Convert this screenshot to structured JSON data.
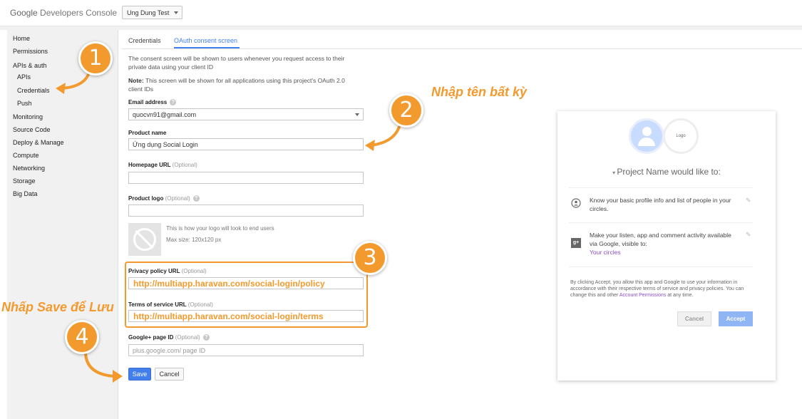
{
  "header": {
    "logo_google": "Google",
    "logo_product": "Developers Console",
    "project": "Ung Dung Test"
  },
  "sidebar": {
    "items": [
      {
        "label": "Home"
      },
      {
        "label": "Permissions"
      },
      {
        "label": "APIs & auth"
      },
      {
        "label": "APIs"
      },
      {
        "label": "Credentials"
      },
      {
        "label": "Push"
      },
      {
        "label": "Monitoring"
      },
      {
        "label": "Source Code"
      },
      {
        "label": "Deploy & Manage"
      },
      {
        "label": "Compute"
      },
      {
        "label": "Networking"
      },
      {
        "label": "Storage"
      },
      {
        "label": "Big Data"
      }
    ]
  },
  "tabs": [
    {
      "label": "Credentials"
    },
    {
      "label": "OAuth consent screen"
    }
  ],
  "form": {
    "intro_line1": "The consent screen will be shown to users whenever you request access to their",
    "intro_line2": "private data using your client ID",
    "note_label": "Note:",
    "note_line1": " This screen will be shown for all applications using this project's OAuth 2.0",
    "note_line2": "client IDs",
    "email_label": "Email address",
    "email_value": "quocvn91@gmail.com",
    "product_label": "Product name",
    "product_value": "Ứng dụng Social Login",
    "homepage_label": "Homepage URL",
    "homepage_opt": "(Optional)",
    "logo_label": "Product logo",
    "logo_opt": "(Optional)",
    "logo_hint1": "This is how your logo will look to end users",
    "logo_hint2": "Max size: 120x120 px",
    "privacy_label": "Privacy policy URL",
    "privacy_opt": "(Optional)",
    "privacy_value": "http://multiapp.haravan.com/social-login/policy",
    "terms_label": "Terms of service URL",
    "terms_opt": "(Optional)",
    "terms_value": "http://multiapp.haravan.com/social-login/terms",
    "gplus_label": "Google+ page ID",
    "gplus_opt": "(Optional)",
    "gplus_placeholder": "plus.google.com/ page ID",
    "save": "Save",
    "cancel": "Cancel"
  },
  "annotations": {
    "n1": "1",
    "n2": "2",
    "n3": "3",
    "n4": "4",
    "step2_text": "Nhập tên bất kỳ",
    "step4_text": "Nhấp Save để Lưu",
    "color": "#f39a2e"
  },
  "preview": {
    "logo_text": "Logo",
    "title": "Project Name would like to:",
    "perm1_line1": "Know your basic profile info and list of people in your",
    "perm1_line2": "circles.",
    "perm2_line1": "Make your listen, app and comment activity available",
    "perm2_line2": "via Google, visible to:",
    "perm2_link": "Your circles",
    "legal_1": "By clicking Accept, you allow this app and Google to use your information in",
    "legal_2": "accordance with their respective terms of service and privacy policies. You can",
    "legal_3a": "change this and other ",
    "legal_3_link": "Account Permissions",
    "legal_3b": " at any time.",
    "cancel": "Cancel",
    "accept": "Accept"
  },
  "colors": {
    "accent_blue": "#427fed",
    "annotation_orange": "#f39a2e"
  }
}
